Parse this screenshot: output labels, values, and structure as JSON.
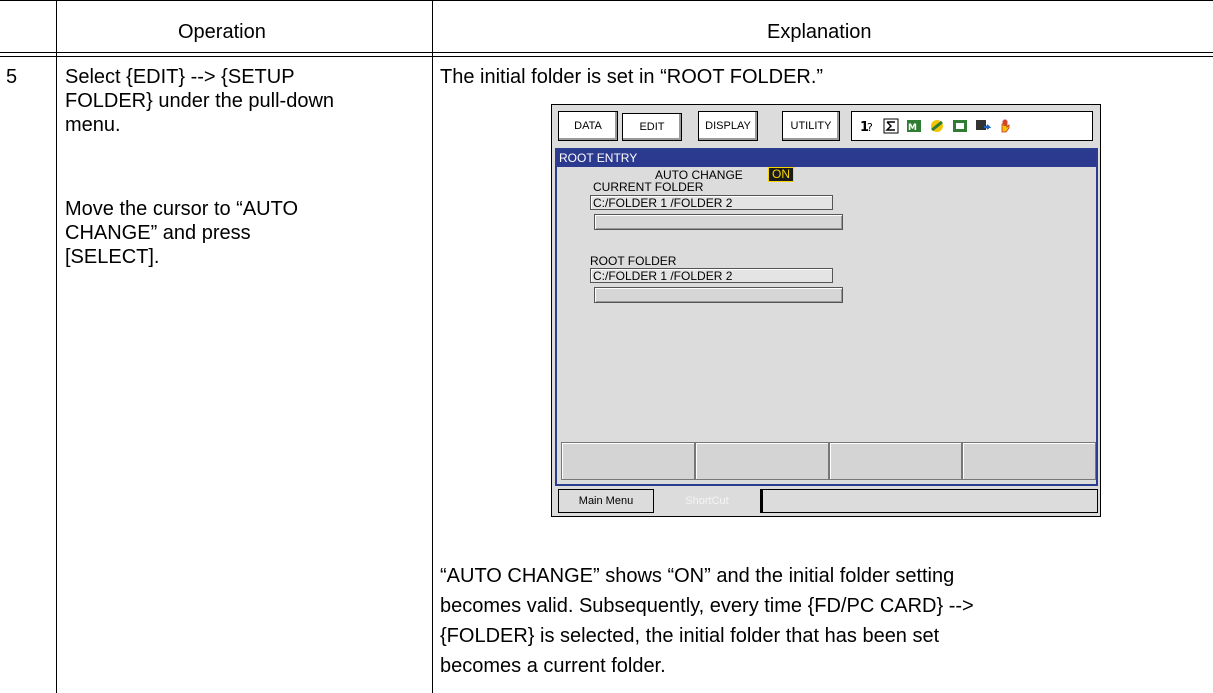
{
  "table": {
    "header_operation": "Operation",
    "header_explanation": "Explanation",
    "step_number": "5",
    "operation": [
      "Select {EDIT} --> {SETUP",
      "FOLDER} under the pull-down",
      "menu.",
      "Move the cursor to “AUTO",
      "CHANGE” and press",
      "[SELECT]."
    ],
    "explanation_intro": "The initial folder is set in “ROOT FOLDER.”",
    "explanation_after": [
      "“AUTO CHANGE” shows “ON” and the initial folder setting",
      "becomes valid. Subsequently, every time {FD/PC CARD} -->",
      "{FOLDER} is selected, the initial folder that has been set",
      "becomes a current folder."
    ]
  },
  "screen": {
    "menu": {
      "data": "DATA",
      "edit": "EDIT",
      "display": "DISPLAY",
      "utility": "UTILITY"
    },
    "status_icons": [
      "coordinate-icon",
      "sigma-icon",
      "mode-icon",
      "robot-icon",
      "teach-icon",
      "cycle-icon",
      "hand-icon"
    ],
    "window_title": "ROOT ENTRY",
    "auto_change_label": "AUTO CHANGE",
    "auto_change_value": "ON",
    "current_folder_label": "CURRENT FOLDER",
    "current_folder_value": "C:/FOLDER 1 /FOLDER 2",
    "root_folder_label": "ROOT FOLDER",
    "root_folder_value": "C:/FOLDER 1 /FOLDER 2",
    "main_menu_label": "Main Menu",
    "shortcut_label": "ShortCut",
    "accent_title_color": "#2b3a8f",
    "on_badge_color": "#f7d800"
  }
}
